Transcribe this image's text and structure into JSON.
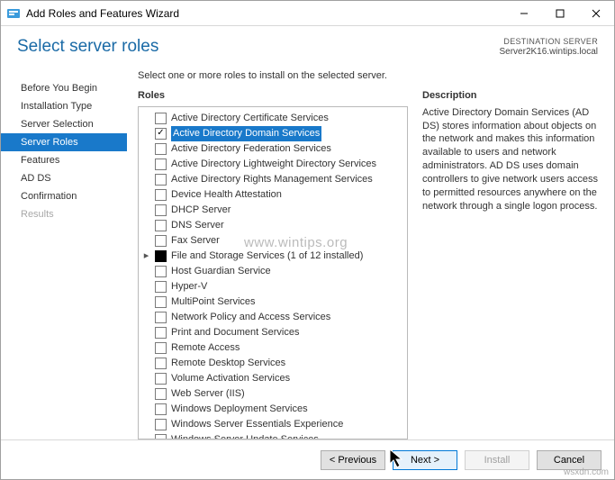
{
  "window": {
    "title": "Add Roles and Features Wizard"
  },
  "header": {
    "title": "Select server roles",
    "dest_label": "DESTINATION SERVER",
    "dest_server": "Server2K16.wintips.local"
  },
  "sidebar": {
    "items": [
      {
        "label": "Before You Begin",
        "active": false,
        "disabled": false
      },
      {
        "label": "Installation Type",
        "active": false,
        "disabled": false
      },
      {
        "label": "Server Selection",
        "active": false,
        "disabled": false
      },
      {
        "label": "Server Roles",
        "active": true,
        "disabled": false
      },
      {
        "label": "Features",
        "active": false,
        "disabled": false
      },
      {
        "label": "AD DS",
        "active": false,
        "disabled": false
      },
      {
        "label": "Confirmation",
        "active": false,
        "disabled": false
      },
      {
        "label": "Results",
        "active": false,
        "disabled": true
      }
    ]
  },
  "content": {
    "instruction": "Select one or more roles to install on the selected server.",
    "roles_header": "Roles",
    "description_header": "Description",
    "description_text": "Active Directory Domain Services (AD DS) stores information about objects on the network and makes this information available to users and network administrators. AD DS uses domain controllers to give network users access to permitted resources anywhere on the network through a single logon process.",
    "roles": [
      {
        "label": "Active Directory Certificate Services",
        "checked": false,
        "selected": false,
        "expandable": false,
        "partial": false
      },
      {
        "label": "Active Directory Domain Services",
        "checked": true,
        "selected": true,
        "expandable": false,
        "partial": false
      },
      {
        "label": "Active Directory Federation Services",
        "checked": false,
        "selected": false,
        "expandable": false,
        "partial": false
      },
      {
        "label": "Active Directory Lightweight Directory Services",
        "checked": false,
        "selected": false,
        "expandable": false,
        "partial": false
      },
      {
        "label": "Active Directory Rights Management Services",
        "checked": false,
        "selected": false,
        "expandable": false,
        "partial": false
      },
      {
        "label": "Device Health Attestation",
        "checked": false,
        "selected": false,
        "expandable": false,
        "partial": false
      },
      {
        "label": "DHCP Server",
        "checked": false,
        "selected": false,
        "expandable": false,
        "partial": false
      },
      {
        "label": "DNS Server",
        "checked": false,
        "selected": false,
        "expandable": false,
        "partial": false
      },
      {
        "label": "Fax Server",
        "checked": false,
        "selected": false,
        "expandable": false,
        "partial": false
      },
      {
        "label": "File and Storage Services (1 of 12 installed)",
        "checked": false,
        "selected": false,
        "expandable": true,
        "partial": true
      },
      {
        "label": "Host Guardian Service",
        "checked": false,
        "selected": false,
        "expandable": false,
        "partial": false
      },
      {
        "label": "Hyper-V",
        "checked": false,
        "selected": false,
        "expandable": false,
        "partial": false
      },
      {
        "label": "MultiPoint Services",
        "checked": false,
        "selected": false,
        "expandable": false,
        "partial": false
      },
      {
        "label": "Network Policy and Access Services",
        "checked": false,
        "selected": false,
        "expandable": false,
        "partial": false
      },
      {
        "label": "Print and Document Services",
        "checked": false,
        "selected": false,
        "expandable": false,
        "partial": false
      },
      {
        "label": "Remote Access",
        "checked": false,
        "selected": false,
        "expandable": false,
        "partial": false
      },
      {
        "label": "Remote Desktop Services",
        "checked": false,
        "selected": false,
        "expandable": false,
        "partial": false
      },
      {
        "label": "Volume Activation Services",
        "checked": false,
        "selected": false,
        "expandable": false,
        "partial": false
      },
      {
        "label": "Web Server (IIS)",
        "checked": false,
        "selected": false,
        "expandable": false,
        "partial": false
      },
      {
        "label": "Windows Deployment Services",
        "checked": false,
        "selected": false,
        "expandable": false,
        "partial": false
      },
      {
        "label": "Windows Server Essentials Experience",
        "checked": false,
        "selected": false,
        "expandable": false,
        "partial": false
      },
      {
        "label": "Windows Server Update Services",
        "checked": false,
        "selected": false,
        "expandable": false,
        "partial": false
      }
    ]
  },
  "footer": {
    "previous": "< Previous",
    "next": "Next >",
    "install": "Install",
    "cancel": "Cancel"
  },
  "watermark": "www.wintips.org",
  "srcmark": "wsxdn.com"
}
